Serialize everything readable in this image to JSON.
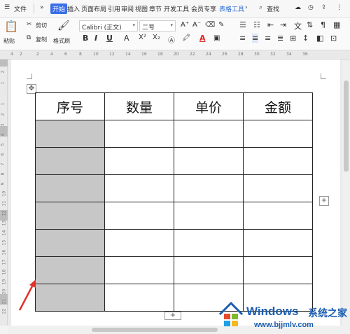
{
  "menubar": {
    "menu_label": "文件",
    "more": "»",
    "tabs": [
      "开始",
      "插入",
      "页面布局",
      "引用",
      "审阅",
      "视图",
      "章节",
      "开发工具",
      "会员专享",
      "表格工具"
    ],
    "next": "›",
    "search": "查找"
  },
  "ribbon": {
    "paste": "粘贴",
    "cut": "剪切",
    "copy": "复制",
    "format_painter": "格式刷",
    "font_name": "Calibri (正文)",
    "font_size": "二号",
    "bold": "B",
    "italic": "I",
    "underline": "U",
    "strike": "A",
    "superscript": "X²",
    "subscript": "X₂",
    "font_color": "A",
    "grow": "A⁺",
    "shrink": "A⁻"
  },
  "ruler": {
    "h_numbers": [
      "4",
      "2",
      "2",
      "4",
      "6",
      "8",
      "10",
      "12",
      "14",
      "16",
      "18",
      "20",
      "22",
      "24",
      "26",
      "28",
      "30",
      "32",
      "34",
      "36"
    ],
    "v_numbers": [
      "2",
      "1",
      "1",
      "2",
      "3",
      "4",
      "5",
      "6",
      "7",
      "8",
      "9",
      "10",
      "11",
      "12",
      "13",
      "14",
      "15",
      "16",
      "17",
      "18",
      "19",
      "20",
      "21",
      "22"
    ]
  },
  "table": {
    "headers": [
      "序号",
      "数量",
      "单价",
      "金额"
    ],
    "rows": [
      [
        "",
        "",
        "",
        ""
      ],
      [
        "",
        "",
        "",
        ""
      ],
      [
        "",
        "",
        "",
        ""
      ],
      [
        "",
        "",
        "",
        ""
      ],
      [
        "",
        "",
        "",
        ""
      ],
      [
        "",
        "",
        "",
        ""
      ],
      [
        "",
        "",
        "",
        ""
      ]
    ],
    "shade_color": "#c7c7c7"
  },
  "controls": {
    "move_handle": "✥",
    "add_column": "+",
    "add_row": "+"
  },
  "watermark": {
    "title": "Windows",
    "subtitle": "系统之家",
    "url": "www.bjjmlv.com"
  },
  "colors": {
    "accent": "#3a6ee8",
    "table_tools_tab": "#2f6fd6",
    "arrow": "#e0322c"
  }
}
